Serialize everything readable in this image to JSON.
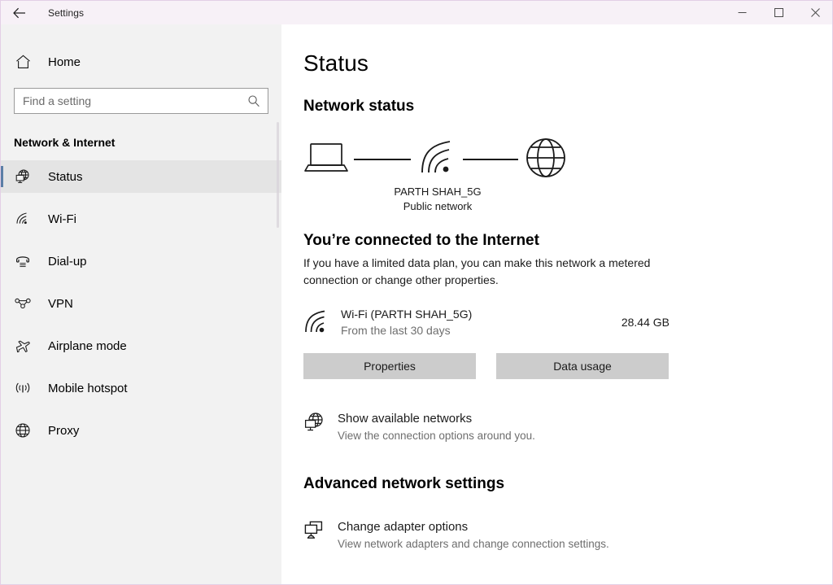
{
  "titlebar": {
    "back_icon": "back-arrow-icon",
    "title": "Settings",
    "minimize_label": "─",
    "maximize_label": "☐",
    "close_label": "✕"
  },
  "sidebar": {
    "home": {
      "label": "Home",
      "icon": "home-icon"
    },
    "search": {
      "value": "",
      "placeholder": "Find a setting",
      "icon": "search-icon"
    },
    "category": "Network & Internet",
    "items": [
      {
        "label": "Status",
        "icon": "globe-monitor-icon",
        "selected": true
      },
      {
        "label": "Wi-Fi",
        "icon": "wifi-icon",
        "selected": false
      },
      {
        "label": "Dial-up",
        "icon": "dialup-phone-icon",
        "selected": false
      },
      {
        "label": "VPN",
        "icon": "vpn-icon",
        "selected": false
      },
      {
        "label": "Airplane mode",
        "icon": "airplane-icon",
        "selected": false
      },
      {
        "label": "Mobile hotspot",
        "icon": "hotspot-icon",
        "selected": false
      },
      {
        "label": "Proxy",
        "icon": "globe-icon",
        "selected": false
      }
    ],
    "accent_color": "#5b7ea6",
    "background_color": "#f2f2f2"
  },
  "main": {
    "page_title": "Status",
    "network_status_heading": "Network status",
    "diagram": {
      "device_icon": "laptop-icon",
      "link_icon": "wifi-signal-icon",
      "internet_icon": "globe-icon",
      "ssid": "PARTH SHAH_5G",
      "network_type": "Public network"
    },
    "connected_heading": "You’re connected to the Internet",
    "connected_description": "If you have a limited data plan, you can make this network a metered connection or change other properties.",
    "usage": {
      "icon": "wifi-icon",
      "title": "Wi-Fi (PARTH SHAH_5G)",
      "subtitle": "From the last 30 days",
      "amount": "28.44 GB"
    },
    "buttons": {
      "properties": "Properties",
      "data_usage": "Data usage"
    },
    "show_networks": {
      "icon": "globe-monitor-icon",
      "title": "Show available networks",
      "subtitle": "View the connection options around you."
    },
    "advanced_heading": "Advanced network settings",
    "change_adapter": {
      "icon": "adapter-monitors-icon",
      "title": "Change adapter options",
      "subtitle": "View network adapters and change connection settings."
    }
  }
}
